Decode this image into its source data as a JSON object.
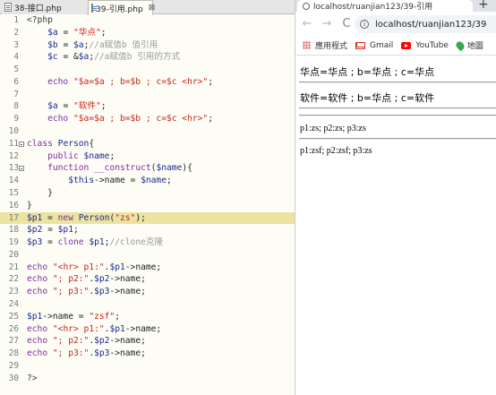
{
  "editor": {
    "tabs": [
      {
        "label": "38-接口.php"
      },
      {
        "label": "39-引用.php",
        "close": "⊠"
      }
    ],
    "lines": [
      {
        "n": "1",
        "html": "<span class='o'>&lt;?php</span>"
      },
      {
        "n": "2",
        "html": "    <span class='v'>$a</span> = <span class='s'>\"华点\"</span>;"
      },
      {
        "n": "3",
        "html": "    <span class='v'>$b</span> = <span class='v'>$a</span>;<span class='c'>//a赋值b 值引用</span>"
      },
      {
        "n": "4",
        "html": "    <span class='v'>$c</span> = &amp;<span class='v'>$a</span>;<span class='c'>//a赋值b 引用的方式</span>"
      },
      {
        "n": "5",
        "html": ""
      },
      {
        "n": "6",
        "html": "    <span class='k'>echo</span> <span class='s'>\"$a=$a ; b=$b ; c=$c &lt;hr&gt;\"</span>;"
      },
      {
        "n": "7",
        "html": ""
      },
      {
        "n": "8",
        "html": "    <span class='v'>$a</span> = <span class='s'>\"软件\"</span>;"
      },
      {
        "n": "9",
        "html": "    <span class='k'>echo</span> <span class='s'>\"$a=$a ; b=$b ; c=$c &lt;hr&gt;\"</span>;"
      },
      {
        "n": "10",
        "html": ""
      },
      {
        "n": "11",
        "html": "<span class='k'>class</span> <span class='v'>Person</span>{",
        "fold": true
      },
      {
        "n": "12",
        "html": "    <span class='k'>public</span> <span class='v'>$name</span>;"
      },
      {
        "n": "13",
        "html": "    <span class='k'>function</span> <span class='k'>__construct</span>(<span class='v'>$name</span>){",
        "fold": true
      },
      {
        "n": "14",
        "html": "        <span class='v'>$this</span>-&gt;name = <span class='v'>$name</span>;"
      },
      {
        "n": "15",
        "html": "    }"
      },
      {
        "n": "16",
        "html": "}"
      },
      {
        "n": "17",
        "html": "<span class='v'>$p1</span> = <span class='k'>new</span> <span class='v'>Person</span>(<span class='s'>\"zs\"</span>);",
        "hl": true
      },
      {
        "n": "18",
        "html": "<span class='v'>$p2</span> = <span class='v'>$p1</span>;"
      },
      {
        "n": "19",
        "html": "<span class='v'>$p3</span> = <span class='k'>clone</span> <span class='v'>$p1</span>;<span class='c'>//clone克隆</span>"
      },
      {
        "n": "20",
        "html": ""
      },
      {
        "n": "21",
        "html": "<span class='k'>echo</span> <span class='s'>\"&lt;hr&gt; p1:\"</span>.<span class='v'>$p1</span>-&gt;name;"
      },
      {
        "n": "22",
        "html": "<span class='k'>echo</span> <span class='s'>\"; p2:\"</span>.<span class='v'>$p2</span>-&gt;name;"
      },
      {
        "n": "23",
        "html": "<span class='k'>echo</span> <span class='s'>\"; p3:\"</span>.<span class='v'>$p3</span>-&gt;name;"
      },
      {
        "n": "24",
        "html": ""
      },
      {
        "n": "25",
        "html": "<span class='v'>$p1</span>-&gt;name = <span class='s'>\"zsf\"</span>;"
      },
      {
        "n": "26",
        "html": "<span class='k'>echo</span> <span class='s'>\"&lt;hr&gt; p1:\"</span>.<span class='v'>$p1</span>-&gt;name;"
      },
      {
        "n": "27",
        "html": "<span class='k'>echo</span> <span class='s'>\"; p2:\"</span>.<span class='v'>$p2</span>-&gt;name;"
      },
      {
        "n": "28",
        "html": "<span class='k'>echo</span> <span class='s'>\"; p3:\"</span>.<span class='v'>$p3</span>-&gt;name;"
      },
      {
        "n": "29",
        "html": ""
      },
      {
        "n": "30",
        "html": "<span class='o'>?&gt;</span>"
      }
    ]
  },
  "browser": {
    "tab_title": "localhost/ruanjian123/39-引用",
    "new_tab": "+",
    "back": "←",
    "forward": "→",
    "reload": "C",
    "url": "localhost/ruanjian123/39",
    "info_icon": "i",
    "bookmarks": [
      {
        "label": "應用程式",
        "icon": "apps-icon"
      },
      {
        "label": "Gmail",
        "icon": "gmail-icon"
      },
      {
        "label": "YouTube",
        "icon": "youtube-icon"
      },
      {
        "label": "地圖",
        "icon": "maps-icon"
      }
    ],
    "output": {
      "line1": "华点=华点 ; b=华点 ; c=华点",
      "line2": "软件=软件 ; b=华点 ; c=软件",
      "line3": "p1:zs; p2:zs; p3:zs",
      "line4": "p1:zsf; p2:zsf; p3:zs"
    }
  }
}
